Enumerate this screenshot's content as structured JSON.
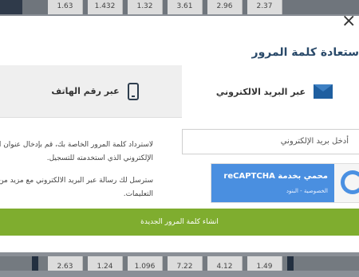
{
  "top_odds": [
    "1.63",
    "1.432",
    "1.32",
    "3.61",
    "2.96",
    "2.37"
  ],
  "bottom_odds": [
    "2.63",
    "1.24",
    "1.096",
    "7.22",
    "4.12",
    "1.49"
  ],
  "modal": {
    "close_symbol": "×",
    "title": "ستعادة كلمة المرور",
    "tab_phone_label": "عبر رقم الهاتف",
    "tab_email_label": "عبر البريد الالكتروني",
    "info_line1": "لاسترداد كلمة المرور الخاصة بك، قم بإدخال عنوان البريد",
    "info_line2": "الإلكتروني الذي استخدمته للتسجيل.",
    "info_line3": "سترسل لك رسالة عبر البريد الالكتروني مع مزيد من",
    "info_line4": "التعليمات.",
    "email_placeholder": "أدخل بريد الإلكتروني",
    "captcha_brand": "محمي بخدمة reCAPTCHA",
    "captcha_links": "الخصوصية - البنود",
    "submit_label": "انشاء كلمة المرور الجديدة"
  },
  "colors": {
    "accent_green": "#7fad2f",
    "icon_blue": "#1f5fa0",
    "title_color": "#2a4a6a"
  }
}
